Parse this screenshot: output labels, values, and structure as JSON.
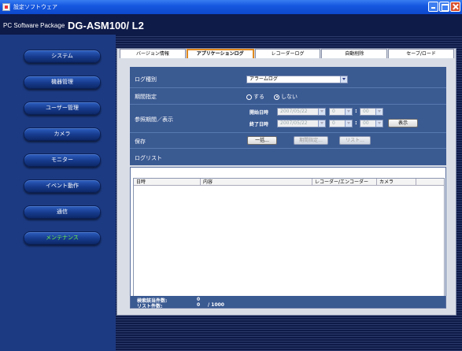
{
  "window": {
    "title": "設定ソフトウェア"
  },
  "header": {
    "package": "PC Software Package",
    "model": "DG-ASM100/ L2"
  },
  "sidebar": {
    "items": [
      {
        "label": "システム"
      },
      {
        "label": "機器管理"
      },
      {
        "label": "ユーザー管理"
      },
      {
        "label": "カメラ"
      },
      {
        "label": "モニター"
      },
      {
        "label": "イベント動作"
      },
      {
        "label": "通信"
      },
      {
        "label": "メンテナンス",
        "active": true
      }
    ]
  },
  "tabs": [
    {
      "label": "バージョン情報"
    },
    {
      "label": "アプリケーションログ",
      "active": true
    },
    {
      "label": "レコーダーログ"
    },
    {
      "label": "自動削除"
    },
    {
      "label": "セーブ/ロード"
    }
  ],
  "form": {
    "log_type": {
      "label": "ログ種別",
      "value": "アラームログ"
    },
    "period": {
      "label": "期間指定",
      "opt_yes": "する",
      "opt_no": "しない",
      "selected": "しない"
    },
    "range": {
      "label": "参照期間／表示",
      "start_label": "開始日時",
      "end_label": "終了日時",
      "start_date": "2007/05/22",
      "end_date": "2007/05/22",
      "start_hour": "0",
      "start_min": "00",
      "end_hour": "0",
      "end_min": "00",
      "colon": ":",
      "display_button": "表示"
    },
    "save": {
      "label": "保存",
      "all_button": "一括...",
      "period_button": "期間指定...",
      "list_button": "リスト..."
    }
  },
  "loglist": {
    "title": "ログリスト",
    "columns": [
      "日時",
      "内容",
      "レコーダー/エンコーダー",
      "カメラ"
    ],
    "rows": [],
    "match_count_label": "検索該当件数:",
    "match_count": "0",
    "list_count_label": "リスト件数:",
    "list_count": "0",
    "list_max": "/ 1000"
  }
}
